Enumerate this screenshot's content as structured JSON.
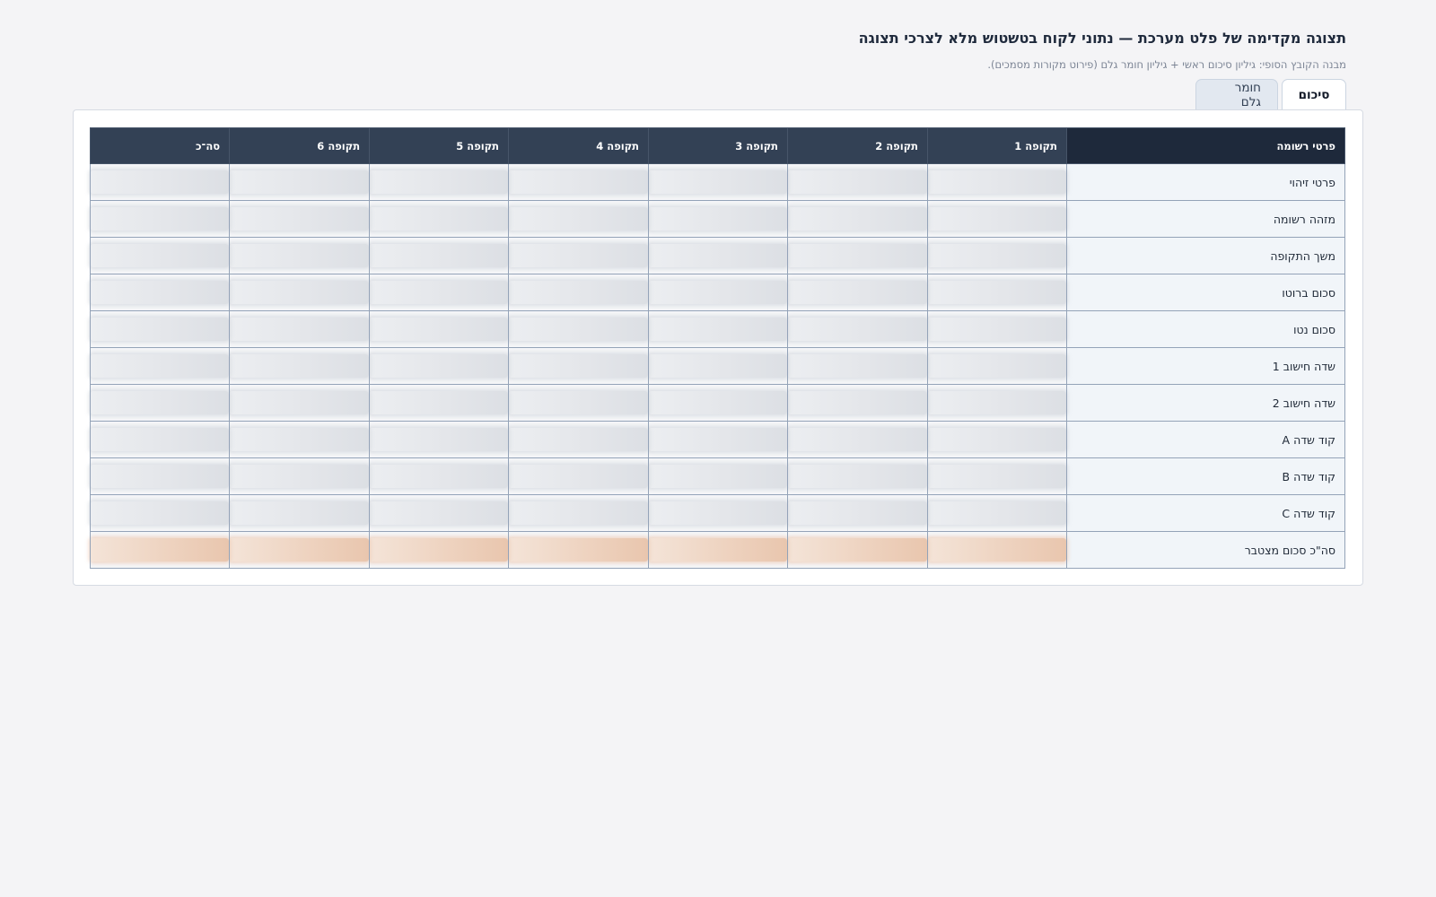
{
  "header": {
    "title": "תצוגה מקדימה של פלט מערכת — נתוני לקוח בטשטוש מלא לצרכי תצוגה",
    "subtitle": "מבנה הקובץ הסופי: גיליון סיכום ראשי + גיליון חומר גלם (פירוט מקורות מסמכים)."
  },
  "tabs": [
    {
      "label": "סיכום",
      "active": true
    },
    {
      "label": "חומר גלם",
      "active": false
    }
  ],
  "table": {
    "columns": [
      "פרטי רשומה",
      "תקופה 1",
      "תקופה 2",
      "תקופה 3",
      "תקופה 4",
      "תקופה 5",
      "תקופה 6",
      "סה־כ"
    ],
    "rows": [
      {
        "label": "פרטי זיהוי",
        "values_blurred": true
      },
      {
        "label": "מזהה רשומה",
        "values_blurred": true
      },
      {
        "label": "משך התקופה",
        "values_blurred": true
      },
      {
        "label": "סכום ברוטו",
        "values_blurred": true
      },
      {
        "label": "סכום נטו",
        "values_blurred": true
      },
      {
        "label": "שדה חישוב 1",
        "values_blurred": true
      },
      {
        "label": "שדה חישוב 2",
        "values_blurred": true
      },
      {
        "label": "קוד שדה A",
        "values_blurred": true
      },
      {
        "label": "קוד שדה B",
        "values_blurred": true
      },
      {
        "label": "קוד שדה C",
        "values_blurred": true
      },
      {
        "label": "סה\"כ סכום מצטבר",
        "values_blurred": true,
        "highlight": true
      }
    ]
  },
  "colors": {
    "header_bg": "#334155",
    "header_first_bg": "#1e293b",
    "label_bg": "#f1f5f9",
    "total_highlight": "#eed3c0"
  }
}
